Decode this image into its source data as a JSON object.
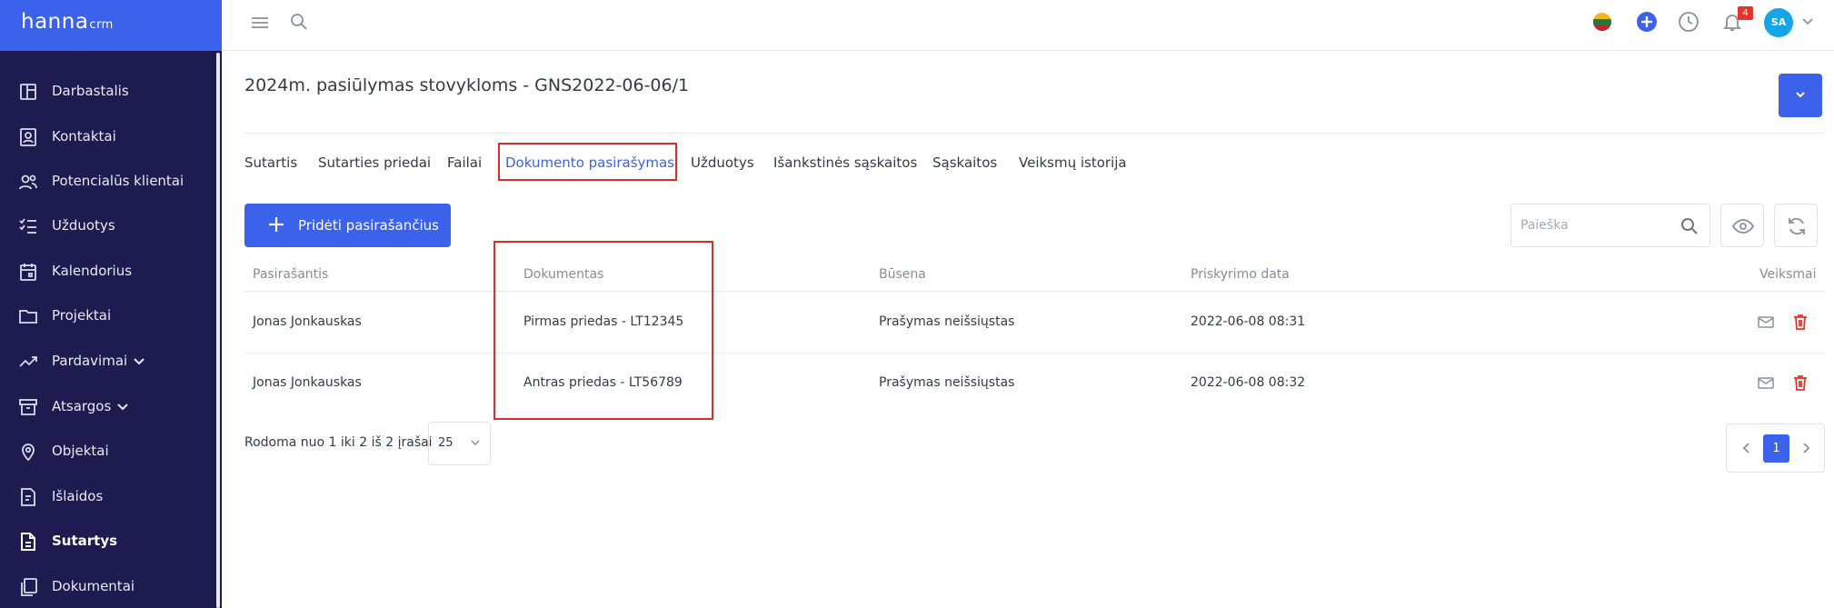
{
  "app": {
    "brand": "hanna",
    "brand_suffix": "crm",
    "accent_color": "#3c62ec",
    "sidebar_color": "#1d1b4f"
  },
  "sidebar": {
    "items": [
      {
        "label": "Darbastalis",
        "icon": "dashboard-icon"
      },
      {
        "label": "Kontaktai",
        "icon": "contacts-icon"
      },
      {
        "label": "Potencialūs klientai",
        "icon": "leads-icon"
      },
      {
        "label": "Užduotys",
        "icon": "tasks-icon"
      },
      {
        "label": "Kalendorius",
        "icon": "calendar-icon"
      },
      {
        "label": "Projektai",
        "icon": "folder-icon"
      },
      {
        "label": "Pardavimai",
        "icon": "sales-icon",
        "expandable": true
      },
      {
        "label": "Atsargos",
        "icon": "inventory-icon",
        "expandable": true
      },
      {
        "label": "Objektai",
        "icon": "location-pin-icon"
      },
      {
        "label": "Išlaidos",
        "icon": "expenses-icon"
      },
      {
        "label": "Sutartys",
        "icon": "contract-icon",
        "active": true
      },
      {
        "label": "Dokumentai",
        "icon": "documents-icon"
      }
    ]
  },
  "topbar": {
    "notification_count": "4",
    "avatar_initials": "SA",
    "language_flag": "lt-flag-icon"
  },
  "page": {
    "title": "2024m. pasiūlymas stovykloms - GNS2022-06-06/1"
  },
  "tabs": [
    {
      "label": "Sutartis"
    },
    {
      "label": "Sutarties priedai"
    },
    {
      "label": "Failai"
    },
    {
      "label": "Dokumento pasirašymas",
      "active": true
    },
    {
      "label": "Užduotys"
    },
    {
      "label": "Išankstinės sąskaitos"
    },
    {
      "label": "Sąskaitos"
    },
    {
      "label": "Veiksmų istorija"
    }
  ],
  "toolbar": {
    "add_label": "Pridėti pasirašančius",
    "search_placeholder": "Paieška"
  },
  "table": {
    "columns": [
      "Pasirašantis",
      "Dokumentas",
      "Būsena",
      "Priskyrimo data",
      "Veiksmai"
    ],
    "rows": [
      {
        "signer": "Jonas Jonkauskas",
        "document": "Pirmas priedas - LT12345",
        "status": "Prašymas neišsiųstas",
        "date": "2022-06-08 08:31"
      },
      {
        "signer": "Jonas Jonkauskas",
        "document": "Antras priedas - LT56789",
        "status": "Prašymas neišsiųstas",
        "date": "2022-06-08 08:32"
      }
    ]
  },
  "pagination": {
    "info": "Rodoma nuo 1 iki 2 iš 2 įrašai",
    "per_page": "25",
    "current_page": "1"
  }
}
